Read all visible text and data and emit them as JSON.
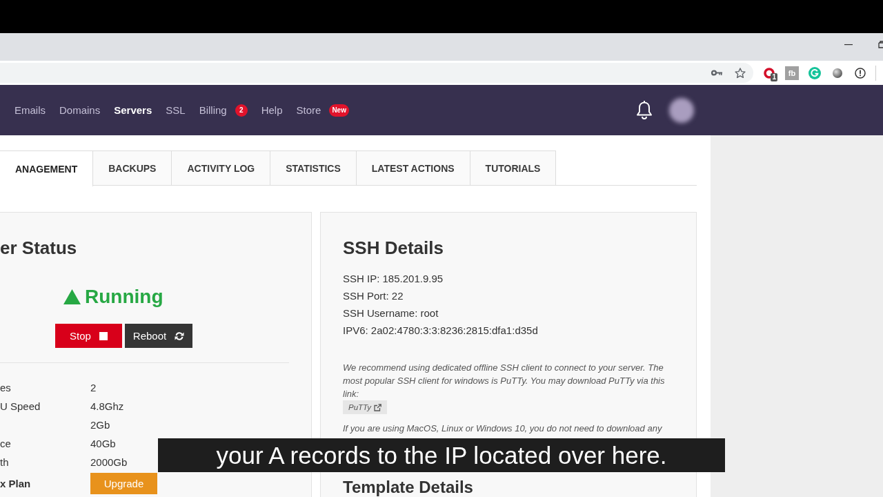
{
  "toolbar": {
    "extensions": [
      {
        "kind": "ring",
        "badge": "1"
      },
      {
        "kind": "tile",
        "label": "fb"
      },
      {
        "kind": "ring_disc"
      },
      {
        "kind": "sphere"
      },
      {
        "kind": "alert"
      }
    ]
  },
  "nav": {
    "items": [
      {
        "label": "Emails",
        "selected": false
      },
      {
        "label": "Domains",
        "selected": false
      },
      {
        "label": "Servers",
        "selected": true
      },
      {
        "label": "SSL",
        "selected": false
      },
      {
        "label": "Billing",
        "selected": false,
        "badge": "2"
      },
      {
        "label": "Help",
        "selected": false
      },
      {
        "label": "Store",
        "selected": false,
        "badge": "New"
      }
    ]
  },
  "tabs": [
    {
      "label": "ANAGEMENT",
      "selected": true
    },
    {
      "label": "BACKUPS",
      "selected": false
    },
    {
      "label": "ACTIVITY LOG",
      "selected": false
    },
    {
      "label": "STATISTICS",
      "selected": false
    },
    {
      "label": "LATEST ACTIONS",
      "selected": false
    },
    {
      "label": "TUTORIALS",
      "selected": false
    }
  ],
  "server_status": {
    "title": "er Status",
    "status": "Running",
    "buttons": [
      {
        "kind": "stop",
        "label": "Stop"
      },
      {
        "kind": "reboot",
        "label": "Reboot"
      }
    ],
    "specs": [
      {
        "kind": "spec",
        "label": "es",
        "value": "2"
      },
      {
        "kind": "spec",
        "label": "U Speed",
        "value": "4.8Ghz"
      },
      {
        "kind": "spec",
        "value": "2Gb"
      },
      {
        "kind": "spec",
        "label": "ce",
        "value": "40Gb"
      },
      {
        "kind": "spec",
        "label": "th",
        "value": "2000Gb"
      },
      {
        "kind": "plan",
        "label": "x Plan",
        "button": "Upgrade"
      }
    ]
  },
  "ssh_details": {
    "title": "SSH Details",
    "lines": [
      "SSH IP: 185.201.9.95",
      "SSH Port: 22",
      "SSH Username: root",
      "IPV6: 2a02:4780:3:3:8236:2815:dfa1:d35d"
    ],
    "note": "We recommend using dedicated offline SSH client to connect to your server. The most popular SSH client for windows is PuTTy. You may download PuTTy via this link:",
    "link": "PuTTy",
    "note_2": "If you are using MacOS, Linux or Windows 10, you do not need to download any"
  },
  "template_details": {
    "title": "Template Details"
  },
  "subtitle": "your A records to the IP located over here."
}
